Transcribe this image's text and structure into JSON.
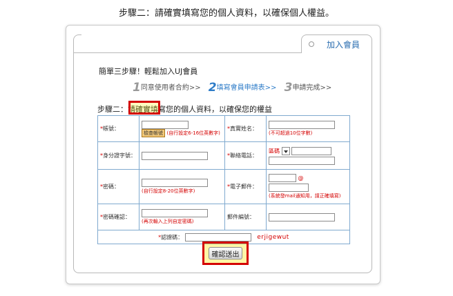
{
  "heading": "步驟二：請確實填寫您的個人資料，以確保個人權益。",
  "tab": {
    "label": "加入會員"
  },
  "intro": "簡單三步驟！輕鬆加入UJ會員",
  "steps": [
    {
      "num": "1",
      "label": "同意使用者合約>>"
    },
    {
      "num": "2",
      "label": "填寫會員申請表>>"
    },
    {
      "num": "3",
      "label": "申請完成>>"
    }
  ],
  "form_subtitle": "步驟二：請確實填寫您的個人資料，以確保您的權益",
  "fields": {
    "account": {
      "label": "帳號：",
      "check_button": "檢查帳號",
      "hint": "(自行設定6-16位英數字)"
    },
    "real_name": {
      "label": "真實姓名：",
      "hint": "(不可超過10位字數)"
    },
    "id_number": {
      "label": "身分證字號："
    },
    "phone": {
      "label": "聯絡電話：",
      "area_code": "區碼"
    },
    "password": {
      "label": "密碼：",
      "hint": "(自行設定8-20位英數字)"
    },
    "email": {
      "label": "電子郵件：",
      "at": "@",
      "hint": "(系統發mail通知用，請正確填寫)"
    },
    "password_confirm": {
      "label": "密碼確認：",
      "hint": "(再次輸入上列自定密碼)"
    },
    "zip": {
      "label": "郵件編號："
    },
    "captcha": {
      "label": "認證碼：",
      "code": "erjigewut"
    }
  },
  "submit_label": "確認送出"
}
